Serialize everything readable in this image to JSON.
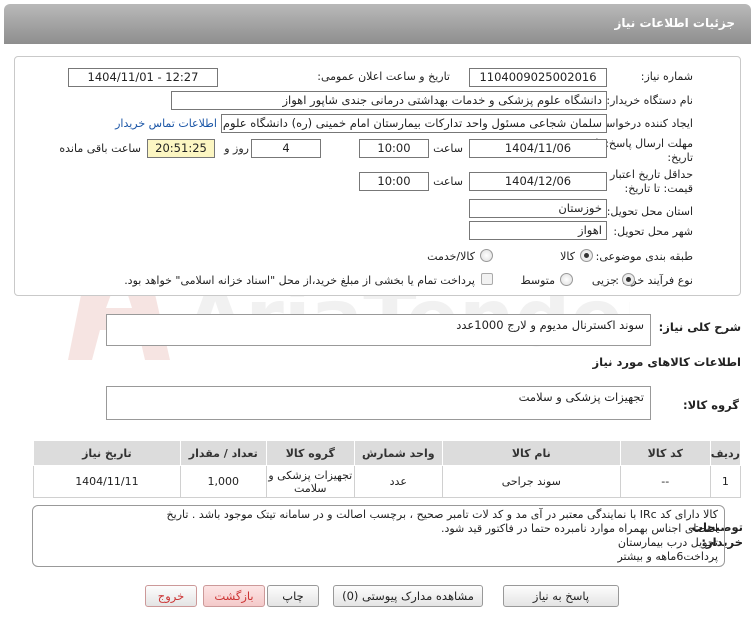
{
  "title": "جزئیات اطلاعات نیاز",
  "form": {
    "need_number_label": "شماره نیاز:",
    "need_number": "1104009025002016",
    "announce_label": "تاریخ و ساعت اعلان عمومی:",
    "announce_value": "1404/11/01 - 12:27",
    "buyer_label": "نام دستگاه خریدار:",
    "buyer_value": "دانشگاه علوم پزشکی و خدمات بهداشتی درمانی جندی شاپور اهواز",
    "requester_label": "ایجاد کننده درخواست:",
    "requester_value": "سلمان شجاعی مسئول واحد تدارکات بیمارستان امام خمینی (ره) دانشگاه علوم",
    "contact_link": "اطلاعات تماس خریدار",
    "deadline_label_1": "مهلت ارسال پاسخ: تا",
    "deadline_label_2": "تاریخ:",
    "deadline_date": "1404/11/06",
    "time_label": "ساعت",
    "deadline_time": "10:00",
    "days_value": "4",
    "days_label": "روز و",
    "remaining_value": "20:51:25",
    "remaining_label": "ساعت باقی مانده",
    "validity_label_1": "حداقل تاریخ اعتبار",
    "validity_label_2": "قیمت: تا تاریخ:",
    "validity_date": "1404/12/06",
    "validity_time": "10:00",
    "province_label": "استان محل تحویل:",
    "province_value": "خوزستان",
    "city_label": "شهر محل تحویل:",
    "city_value": "اهواز",
    "category_label": "طبقه بندی موضوعی:",
    "category_options": [
      "کالا",
      "کالا/خدمت"
    ],
    "category_selected": "کالا",
    "process_label": "نوع فرآیند خرید :",
    "process_options": [
      "جزیی",
      "متوسط"
    ],
    "payment_note": "پرداخت تمام یا بخشی از مبلغ خرید،از محل \"اسناد خزانه اسلامی\" خواهد بود."
  },
  "summary": {
    "label": "شرح کلی نیاز:",
    "value": "سوند اکسترنال  مدیوم و لارج 1000عدد"
  },
  "goods": {
    "section_label": "اطلاعات کالاهای مورد نیاز",
    "group_label": "گروه کالا:",
    "group_value": "تجهیزات پزشکی و سلامت"
  },
  "table": {
    "headers": [
      "ردیف",
      "کد کالا",
      "نام کالا",
      "واحد شمارش",
      "گروه کالا",
      "تعداد / مقدار",
      "تاریخ نیاز"
    ],
    "rows": [
      [
        "1",
        "--",
        "سوند جراحی",
        "عدد",
        "تجهیزات پزشکی و سلامت",
        "1,000",
        "1404/11/11"
      ]
    ]
  },
  "buyer_notes": {
    "label_1": "توضیحات",
    "label_2": "خریدار:",
    "lines": [
      "کالا دارای کد IRc با نمایندگی معتبر در آی مد و کد لات تامبر صحیح ، برچسب اصالت و در سامانه تیتک موجود باشد . تاریخ",
      "انقضای اجناس بهمراه موارد نامبرده حتما در فاکتور قید شود.",
      "تحویل درب بیمارستان",
      "پرداخت6ماهه و بیشتر"
    ]
  },
  "buttons": {
    "reply": "پاسخ به نیاز",
    "attachments": "مشاهده مدارک پیوستی (0)",
    "print": "چاپ",
    "back": "بازگشت",
    "exit": "خروج"
  },
  "watermark": "AriaTender.net"
}
